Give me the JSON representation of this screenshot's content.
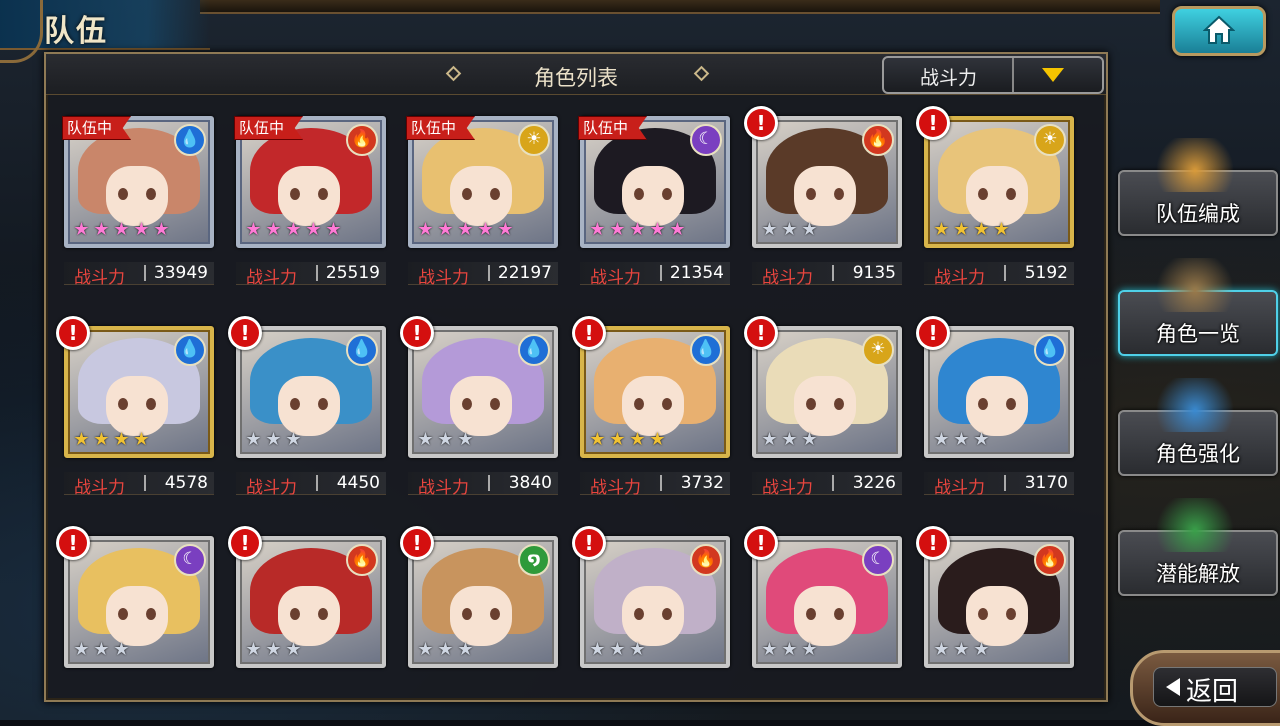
{
  "header": {
    "title": "队伍",
    "home_icon": "home-icon"
  },
  "panel": {
    "title": "角色列表",
    "sort_label": "战斗力"
  },
  "power_label": "战斗力",
  "team_tag": "队伍中",
  "alert_mark": "!",
  "side_menu": [
    {
      "label": "队伍编成",
      "icon": "party-portraits-icon"
    },
    {
      "label": "角色一览",
      "icon": "book-icon",
      "active": true
    },
    {
      "label": "角色强化",
      "icon": "crystal-upgrade-icon"
    },
    {
      "label": "潜能解放",
      "icon": "potential-orb-icon"
    }
  ],
  "back_label": "返回",
  "element_colors": {
    "water": "#1f6fd6",
    "fire": "#d2381f",
    "light": "#d8a51a",
    "dark": "#7a3fc0",
    "wind": "#2f9a3a"
  },
  "characters": [
    {
      "element": "water",
      "symbol": "💧",
      "power": "33949",
      "stars": 5,
      "rarity": "rainbow",
      "frame": "blue",
      "in_team": true,
      "alert": false,
      "hair": "#c9866a"
    },
    {
      "element": "fire",
      "symbol": "🔥",
      "power": "25519",
      "stars": 5,
      "rarity": "rainbow",
      "frame": "blue",
      "in_team": true,
      "alert": false,
      "hair": "#c2282a"
    },
    {
      "element": "light",
      "symbol": "☀",
      "power": "22197",
      "stars": 5,
      "rarity": "rainbow",
      "frame": "blue",
      "in_team": true,
      "alert": false,
      "hair": "#e8c070"
    },
    {
      "element": "dark",
      "symbol": "☾",
      "power": "21354",
      "stars": 5,
      "rarity": "rainbow",
      "frame": "blue",
      "in_team": true,
      "alert": false,
      "hair": "#1d1a22"
    },
    {
      "element": "fire",
      "symbol": "🔥",
      "power": "9135",
      "stars": 3,
      "rarity": "silver",
      "frame": "silver",
      "in_team": false,
      "alert": true,
      "hair": "#5a3a28"
    },
    {
      "element": "light",
      "symbol": "☀",
      "power": "5192",
      "stars": 4,
      "rarity": "gold",
      "frame": "gold",
      "in_team": false,
      "alert": true,
      "hair": "#e8c47a"
    },
    {
      "element": "water",
      "symbol": "💧",
      "power": "4578",
      "stars": 4,
      "rarity": "gold",
      "frame": "gold",
      "in_team": false,
      "alert": true,
      "hair": "#c8c8e0"
    },
    {
      "element": "water",
      "symbol": "💧",
      "power": "4450",
      "stars": 3,
      "rarity": "silver",
      "frame": "silver",
      "in_team": false,
      "alert": true,
      "hair": "#3a90c8"
    },
    {
      "element": "water",
      "symbol": "💧",
      "power": "3840",
      "stars": 3,
      "rarity": "silver",
      "frame": "silver",
      "in_team": false,
      "alert": true,
      "hair": "#b49ad8"
    },
    {
      "element": "water",
      "symbol": "💧",
      "power": "3732",
      "stars": 4,
      "rarity": "gold",
      "frame": "gold",
      "in_team": false,
      "alert": true,
      "hair": "#e8b070"
    },
    {
      "element": "light",
      "symbol": "☀",
      "power": "3226",
      "stars": 3,
      "rarity": "silver",
      "frame": "silver",
      "in_team": false,
      "alert": true,
      "hair": "#eadcb8"
    },
    {
      "element": "water",
      "symbol": "💧",
      "power": "3170",
      "stars": 3,
      "rarity": "silver",
      "frame": "silver",
      "in_team": false,
      "alert": true,
      "hair": "#2f86d0"
    },
    {
      "element": "dark",
      "symbol": "☾",
      "power": "",
      "stars": 3,
      "rarity": "silver",
      "frame": "silver",
      "in_team": false,
      "alert": true,
      "hair": "#e8c060"
    },
    {
      "element": "fire",
      "symbol": "🔥",
      "power": "",
      "stars": 3,
      "rarity": "silver",
      "frame": "silver",
      "in_team": false,
      "alert": true,
      "hair": "#b82a28"
    },
    {
      "element": "wind",
      "symbol": "໑",
      "power": "",
      "stars": 3,
      "rarity": "silver",
      "frame": "silver",
      "in_team": false,
      "alert": true,
      "hair": "#c8945e"
    },
    {
      "element": "fire",
      "symbol": "🔥",
      "power": "",
      "stars": 3,
      "rarity": "silver",
      "frame": "silver",
      "in_team": false,
      "alert": true,
      "hair": "#c0b0c8"
    },
    {
      "element": "dark",
      "symbol": "☾",
      "power": "",
      "stars": 3,
      "rarity": "silver",
      "frame": "silver",
      "in_team": false,
      "alert": true,
      "hair": "#e04a7a"
    },
    {
      "element": "fire",
      "symbol": "🔥",
      "power": "",
      "stars": 3,
      "rarity": "silver",
      "frame": "silver",
      "in_team": false,
      "alert": true,
      "hair": "#2a1c1c"
    }
  ]
}
